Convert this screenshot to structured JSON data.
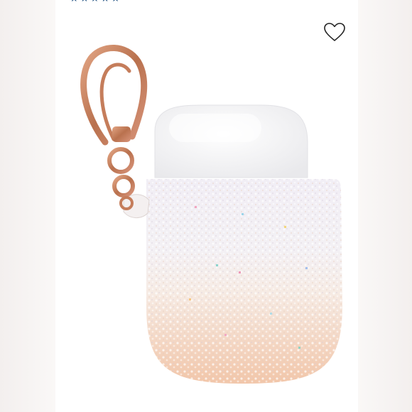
{
  "rating": {
    "stars": 5
  },
  "icons": {
    "favorite": "heart-outline-icon",
    "rating": "star-icon"
  },
  "product": {
    "image": "sanitizer-holder-keychain",
    "colors": {
      "case_top": "#f3f0f4",
      "case_middle": "#f6ebe6",
      "case_bottom": "#f2c9ae",
      "cap": "#f7f7f7",
      "clip": "#c98662"
    }
  }
}
